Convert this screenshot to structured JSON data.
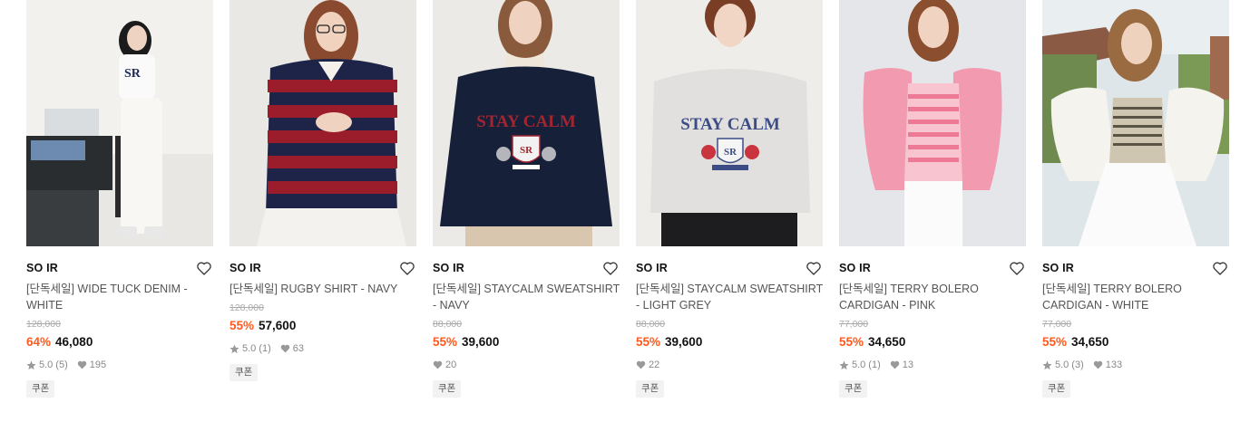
{
  "colors": {
    "discount": "#ff5a1f",
    "brand_text": "#111111",
    "muted": "#888888"
  },
  "products": [
    {
      "brand": "SO IR",
      "title": "[단독세일] WIDE TUCK DENIM - WHITE",
      "original_price": "128,000",
      "discount": "64%",
      "price": "46,080",
      "rating": "5.0",
      "reviews": "(5)",
      "likes": "195",
      "coupon": "쿠폰"
    },
    {
      "brand": "SO IR",
      "title": "[단독세일] RUGBY SHIRT - NAVY",
      "original_price": "128,000",
      "discount": "55%",
      "price": "57,600",
      "rating": "5.0",
      "reviews": "(1)",
      "likes": "63",
      "coupon": "쿠폰"
    },
    {
      "brand": "SO IR",
      "title": "[단독세일] STAYCALM SWEATSHIRT - NAVY",
      "original_price": "88,000",
      "discount": "55%",
      "price": "39,600",
      "rating": "",
      "reviews": "",
      "likes": "20",
      "coupon": "쿠폰"
    },
    {
      "brand": "SO IR",
      "title": "[단독세일] STAYCALM SWEATSHIRT - LIGHT GREY",
      "original_price": "88,000",
      "discount": "55%",
      "price": "39,600",
      "rating": "",
      "reviews": "",
      "likes": "22",
      "coupon": "쿠폰"
    },
    {
      "brand": "SO IR",
      "title": "[단독세일] TERRY BOLERO CARDIGAN - PINK",
      "original_price": "77,000",
      "discount": "55%",
      "price": "34,650",
      "rating": "5.0",
      "reviews": "(1)",
      "likes": "13",
      "coupon": "쿠폰"
    },
    {
      "brand": "SO IR",
      "title": "[단독세일] TERRY BOLERO CARDIGAN - WHITE",
      "original_price": "77,000",
      "discount": "55%",
      "price": "34,650",
      "rating": "5.0",
      "reviews": "(3)",
      "likes": "133",
      "coupon": "쿠폰"
    }
  ],
  "icons": {
    "wishlist": "heart-outline-icon",
    "rating": "star-icon",
    "likes": "heart-filled-icon"
  }
}
